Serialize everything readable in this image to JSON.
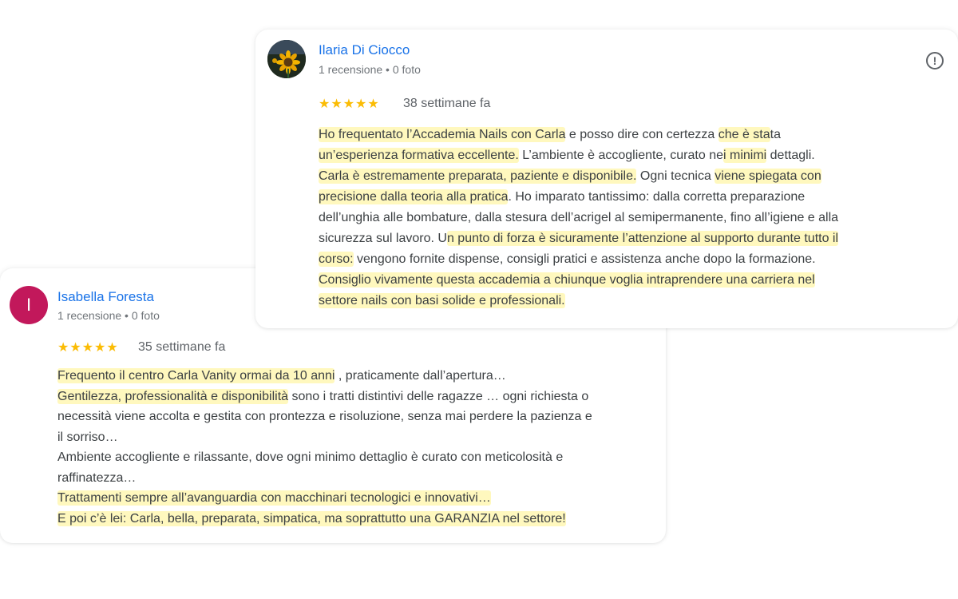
{
  "reviews": [
    {
      "author": "Ilaria Di Ciocco",
      "meta": "1 recensione • 0 foto",
      "stars": "★★★★★",
      "date": "38 settimane fa",
      "rating": 5,
      "flag_icon": "report-flag-icon",
      "lines": {
        "l1a": "Ho frequentato l’Accademia Nails con Carla",
        "l1b": " e posso dire con certezza ",
        "l1c": "che è sta",
        "l1d": "ta",
        "l2a": "un’esperienza formativa eccellente.",
        "l2b": " L’ambiente è accogliente, curato ne",
        "l2c": "i minimi",
        "l2d": " dettagli.",
        "l3a": "Carla è estremamente preparata, paziente e disponibile.",
        "l3b": " Ogni tecnica ",
        "l3c": "viene spiegata con",
        "l4a": "precisione dalla teoria alla pratica",
        "l4b": ". Ho imparato tantissimo: dalla corretta preparazione",
        "l5": "dell’unghia alle bombature, dalla stesura dell’acrigel al semipermanente, fino all’igiene e alla",
        "l6a": "sicurezza sul lavoro. U",
        "l6b": "n punto di forza è sicuramente l’attenzione al supporto durante tutto il",
        "l7a": "corso:",
        "l7b": " vengono fornite dispense, consigli pratici e assistenza anche dopo la formazione.",
        "l8": "Consiglio vivamente questa accademia a chiunque voglia intraprendere una carriera nel",
        "l9": "settore nails con basi solide e professionali."
      }
    },
    {
      "author": "Isabella Foresta",
      "initial": "I",
      "meta": "1 recensione • 0 foto",
      "stars": "★★★★★",
      "date": "35 settimane fa",
      "rating": 5,
      "lines": {
        "l1a": "Frequento il centro Carla Vanity ormai da 10 anni",
        "l1b": " , praticamente dall’apertura…",
        "l2a": "Gentilezza, professionalità e disponibilità",
        "l2b": " sono i tratti distintivi delle ragazze … ogni richiesta o",
        "l3": "necessità viene accolta e gestita con prontezza e risoluzione, senza mai perdere la pazienza e",
        "l4": "il sorriso…",
        "l5": "Ambiente accogliente e rilassante, dove ogni minimo dettaglio è curato con meticolosità e",
        "l6": "raffinatezza…",
        "l7": "Trattamenti sempre all’avanguardia con macchinari tecnologici e innovativi…",
        "l8": "E poi c’è lei: Carla, bella, preparata, simpatica, ma soprattutto una GARANZIA nel settore!"
      }
    }
  ],
  "colors": {
    "author_link": "#1a73e8",
    "star": "#fbbc04",
    "highlight": "#fff496",
    "avatar_letter_bg": "#c2185b"
  }
}
